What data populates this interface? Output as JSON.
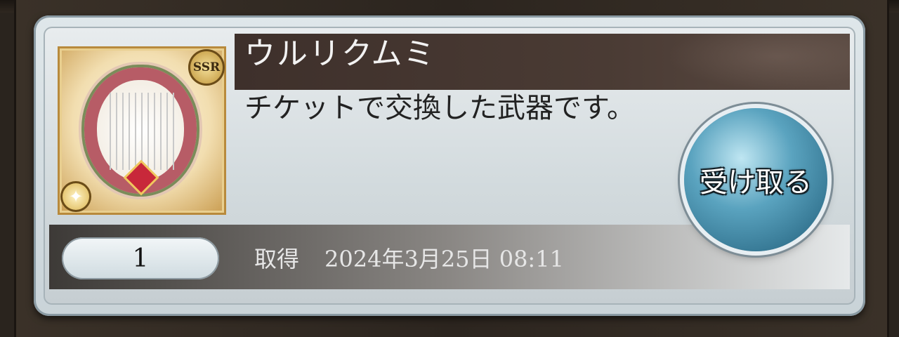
{
  "item": {
    "name": "ウルリクムミ",
    "rarity": "SSR",
    "description": "チケットで交換した武器です。",
    "quantity": "1",
    "acquired_label": "取得",
    "acquired_datetime": "2024年3月25日 08:11"
  },
  "actions": {
    "receive_label": "受け取る"
  },
  "icons": {
    "rarity_badge": "ssr-badge-icon",
    "element": "compass-icon"
  },
  "colors": {
    "title_bar": "#3e302b",
    "button": "#3f86a6",
    "card": "#d8e0e3"
  }
}
